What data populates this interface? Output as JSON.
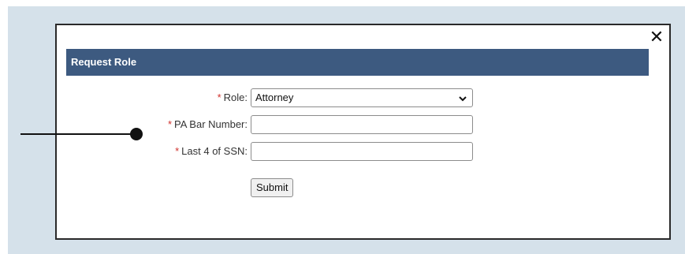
{
  "dialog": {
    "title": "Request Role",
    "close_symbol": "✕"
  },
  "form": {
    "role": {
      "required_mark": "*",
      "label": "Role:",
      "selected_value": "Attorney",
      "chevron_icon": "chevron-down-icon"
    },
    "pa_bar_number": {
      "required_mark": "*",
      "label": "PA Bar Number:",
      "value": ""
    },
    "ssn_last4": {
      "required_mark": "*",
      "label": "Last 4 of SSN:",
      "value": ""
    },
    "submit_label": "Submit"
  },
  "colors": {
    "backdrop": "#d5e1ea",
    "titlebar": "#3d5a80",
    "required": "#d0312d"
  }
}
